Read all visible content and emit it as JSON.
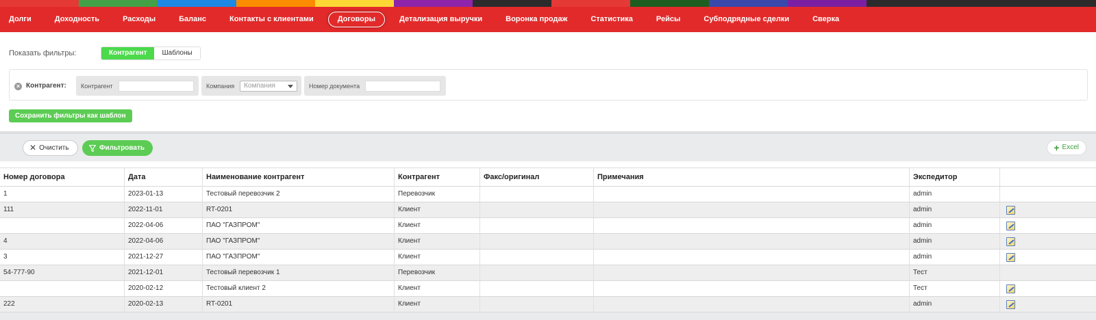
{
  "colors": {
    "nav_bg": "#e22a2a",
    "accent_green": "#5ccc54",
    "segment_active": "#4cd94c"
  },
  "nav": {
    "items": [
      "Долги",
      "Доходность",
      "Расходы",
      "Баланс",
      "Контакты с клиентами",
      "Договоры",
      "Детализация выручки",
      "Воронка продаж",
      "Статистика",
      "Рейсы",
      "Субподрядные сделки",
      "Сверка"
    ],
    "active": "Договоры"
  },
  "filters": {
    "show_label": "Показать фильтры:",
    "segments": [
      "Контрагент",
      "Шаблоны"
    ],
    "panel_title": "Контрагент:",
    "counterparty_label": "Контрагент",
    "company_label": "Компания",
    "company_placeholder": "Компания",
    "doc_number_label": "Номер документа",
    "save_template": "Сохранить фильтры как шаблон"
  },
  "toolbar": {
    "clear": "Очистить",
    "filter": "Фильтровать",
    "excel": "Excel"
  },
  "table": {
    "columns": [
      "Номер договора",
      "Дата",
      "Наименование контрагент",
      "Контрагент",
      "Факс/оригинал",
      "Примечания",
      "Экспедитор",
      ""
    ],
    "rows": [
      {
        "num": "1",
        "date": "2023-01-13",
        "name": "Тестовый перевозчик 2",
        "type": "Перевозчик",
        "fax": "",
        "notes": "",
        "forwarder": "admin",
        "edit": false
      },
      {
        "num": "111",
        "date": "2022-11-01",
        "name": "RT-0201",
        "type": "Клиент",
        "fax": "",
        "notes": "",
        "forwarder": "admin",
        "edit": true
      },
      {
        "num": "",
        "date": "2022-04-06",
        "name": "ПАО \"ГАЗПРОМ\"",
        "type": "Клиент",
        "fax": "",
        "notes": "",
        "forwarder": "admin",
        "edit": true
      },
      {
        "num": "4",
        "date": "2022-04-06",
        "name": "ПАО \"ГАЗПРОМ\"",
        "type": "Клиент",
        "fax": "",
        "notes": "",
        "forwarder": "admin",
        "edit": true
      },
      {
        "num": "3",
        "date": "2021-12-27",
        "name": "ПАО \"ГАЗПРОМ\"",
        "type": "Клиент",
        "fax": "",
        "notes": "",
        "forwarder": "admin",
        "edit": true
      },
      {
        "num": "54-777-90",
        "date": "2021-12-01",
        "name": "Тестовый перевозчик 1",
        "type": "Перевозчик",
        "fax": "",
        "notes": "",
        "forwarder": "Тест",
        "edit": false
      },
      {
        "num": "",
        "date": "2020-02-12",
        "name": "Тестовый клиент 2",
        "type": "Клиент",
        "fax": "",
        "notes": "",
        "forwarder": "Тест",
        "edit": true
      },
      {
        "num": "222",
        "date": "2020-02-13",
        "name": "RT-0201",
        "type": "Клиент",
        "fax": "",
        "notes": "",
        "forwarder": "admin",
        "edit": true
      }
    ]
  }
}
